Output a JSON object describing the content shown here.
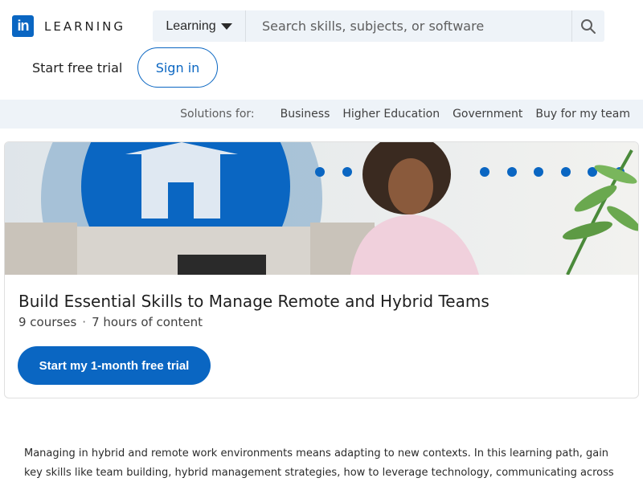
{
  "brand": {
    "logo_mark": "in",
    "product": "LEARNING"
  },
  "search": {
    "category": "Learning",
    "placeholder": "Search skills, subjects, or software",
    "icon": "search-icon"
  },
  "header": {
    "trial_label": "Start free trial",
    "signin_label": "Sign in"
  },
  "solutions": {
    "label": "Solutions for:",
    "links": [
      "Business",
      "Higher Education",
      "Government",
      "Buy for my team"
    ]
  },
  "course": {
    "title": "Build Essential Skills to Manage Remote and Hybrid Teams",
    "courses": "9 courses",
    "separator": "·",
    "hours": "7 hours of content",
    "cta_label": "Start my 1-month free trial"
  },
  "description": "Managing in hybrid and remote work environments means adapting to new contexts. In this learning path, gain key skills like team building, hybrid management strategies, how to leverage technology, communicating across cultures,",
  "colors": {
    "brand_blue": "#0a66c2",
    "bar_bg": "#eef3f8"
  }
}
